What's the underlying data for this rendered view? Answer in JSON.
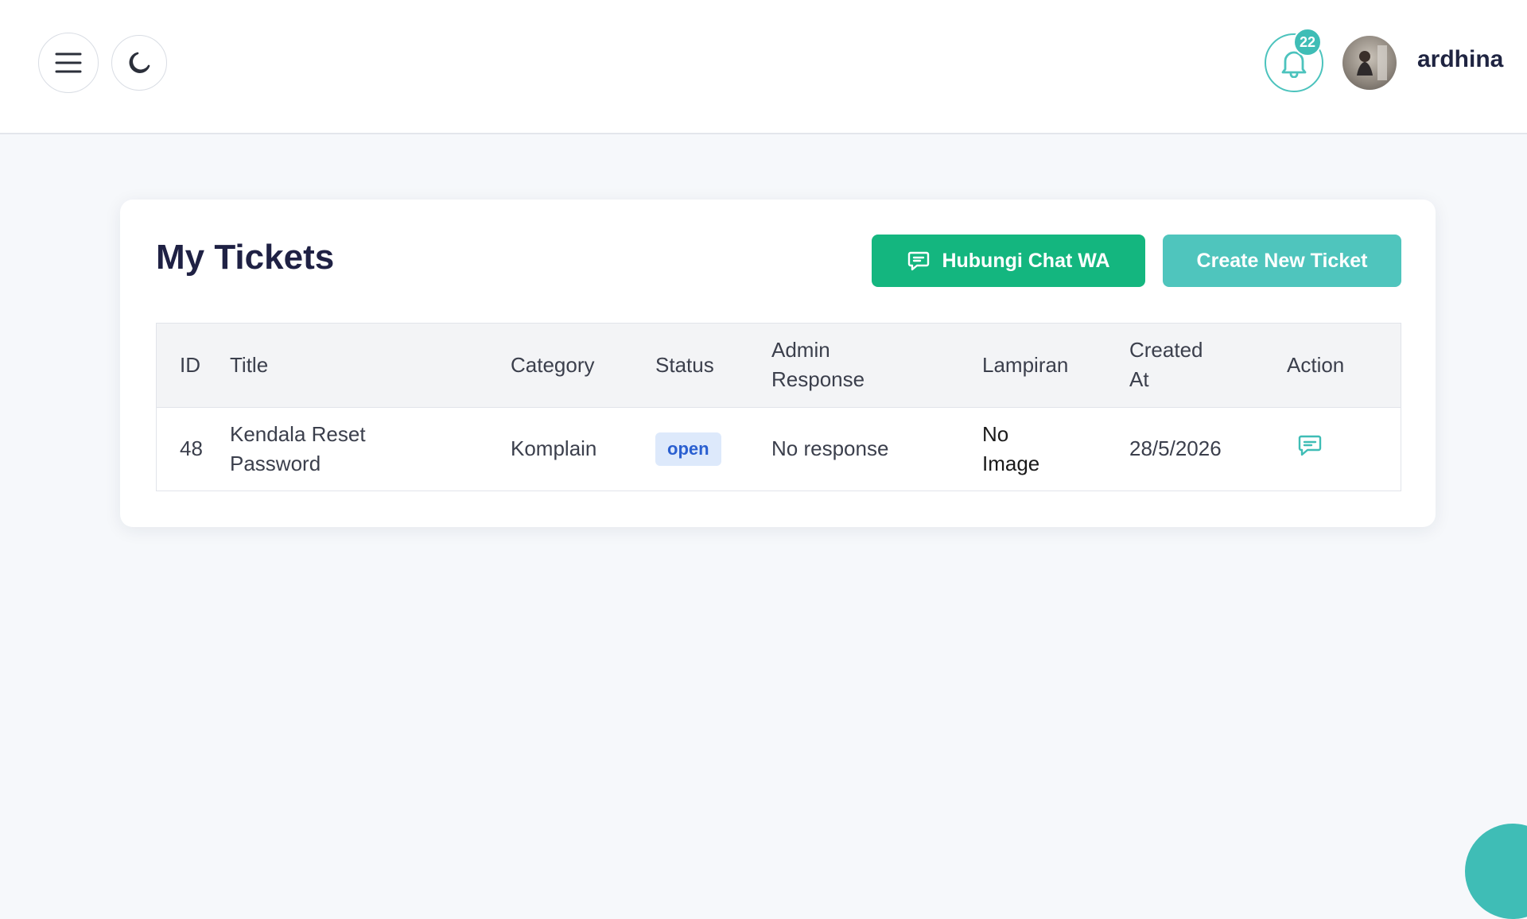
{
  "header": {
    "notification_count": "22",
    "username": "ardhina"
  },
  "page": {
    "title": "My Tickets",
    "wa_button_label": "Hubungi Chat WA",
    "new_ticket_button_label": "Create New Ticket"
  },
  "table": {
    "columns": {
      "id": "ID",
      "title": "Title",
      "category": "Category",
      "status": "Status",
      "admin_response_line1": "Admin",
      "admin_response_line2": "Response",
      "lampiran": "Lampiran",
      "created_line1": "Created",
      "created_line2": "At",
      "action": "Action"
    },
    "rows": [
      {
        "id": "48",
        "title_line1": "Kendala Reset",
        "title_line2": "Password",
        "category": "Komplain",
        "status": "open",
        "admin_response": "No response",
        "lampiran_line1": "No",
        "lampiran_line2": "Image",
        "created_at": "28/5/2026"
      }
    ]
  },
  "icons": {
    "menu": "hamburger-icon",
    "theme": "moon-icon",
    "notification": "bell-icon",
    "chat": "chat-icon"
  },
  "colors": {
    "primary_teal": "#4fc5bd",
    "whatsapp_green": "#14b67f",
    "status_open_bg": "#dde9fb",
    "status_open_text": "#2a5fd0",
    "title_dark": "#1f2144"
  }
}
